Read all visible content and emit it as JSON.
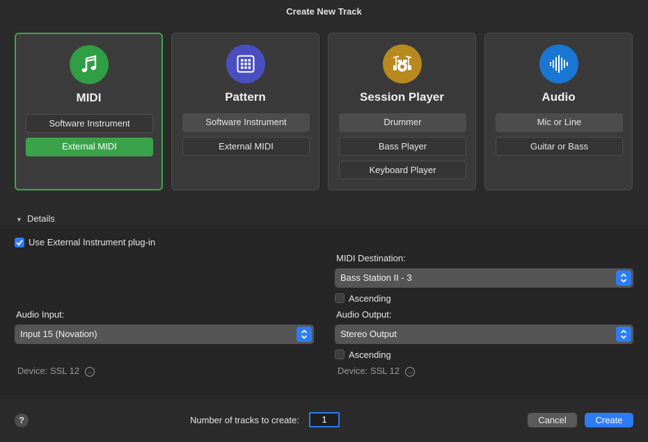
{
  "window": {
    "title": "Create New Track"
  },
  "track_types": [
    {
      "name": "MIDI",
      "icon": "music-note-icon",
      "color": "#2f9e44",
      "selected": true,
      "options": [
        "Software Instrument",
        "External MIDI"
      ],
      "active_option": "External MIDI"
    },
    {
      "name": "Pattern",
      "icon": "grid-icon",
      "color": "#4a4fc0",
      "selected": false,
      "options": [
        "Software Instrument",
        "External MIDI"
      ]
    },
    {
      "name": "Session Player",
      "icon": "drum-kit-icon",
      "color": "#b8891e",
      "selected": false,
      "options": [
        "Drummer",
        "Bass Player",
        "Keyboard Player"
      ]
    },
    {
      "name": "Audio",
      "icon": "waveform-icon",
      "color": "#1976d2",
      "selected": false,
      "options": [
        "Mic or Line",
        "Guitar or Bass"
      ]
    }
  ],
  "details": {
    "header": "Details",
    "use_external_plugin": {
      "label": "Use External Instrument plug-in",
      "checked": true
    },
    "midi_destination": {
      "label": "MIDI Destination:",
      "value": "Bass Station II - 3",
      "ascending_label": "Ascending",
      "ascending_checked": false
    },
    "audio_input": {
      "label": "Audio Input:",
      "value": "Input 15  (Novation)",
      "device": "Device: SSL 12"
    },
    "audio_output": {
      "label": "Audio Output:",
      "value": "Stereo Output",
      "ascending_label": "Ascending",
      "ascending_checked": false,
      "device": "Device: SSL 12"
    }
  },
  "footer": {
    "help": "?",
    "tracks_label": "Number of tracks to create:",
    "tracks_value": "1",
    "cancel": "Cancel",
    "create": "Create"
  },
  "colors": {
    "accent": "#2d7cf6",
    "selected_green": "#3aa34a"
  }
}
